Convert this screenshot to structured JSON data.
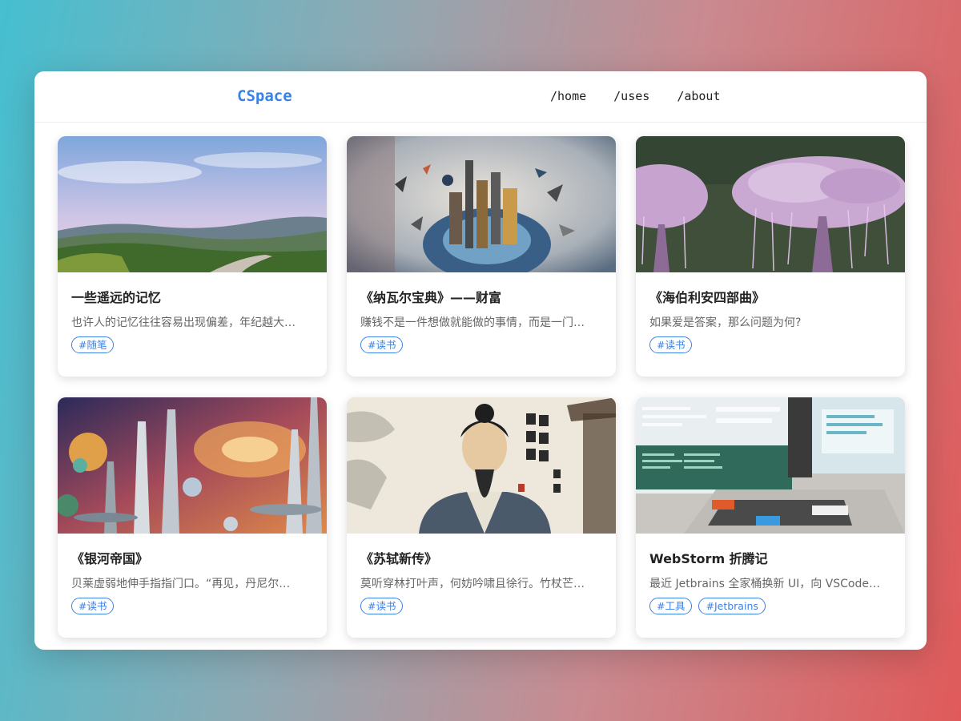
{
  "brand": "CSpace",
  "nav": [
    "/home",
    "/uses",
    "/about"
  ],
  "posts": [
    {
      "title": "一些遥远的记忆",
      "excerpt": "也许人的记忆往往容易出现偏差，年纪越大…",
      "tags": [
        "#随笔"
      ],
      "image": "landscape-hills-photo"
    },
    {
      "title": "《纳瓦尔宝典》——财富",
      "excerpt": "赚钱不是一件想做就能做的事情，而是一门…",
      "tags": [
        "#读书"
      ],
      "image": "abstract-city-collage-illustration"
    },
    {
      "title": "《海伯利安四部曲》",
      "excerpt": "如果爱是答案，那么问题为何?",
      "tags": [
        "#读书"
      ],
      "image": "glowing-pink-trees-illustration"
    },
    {
      "title": "《银河帝国》",
      "excerpt": "贝莱虚弱地伸手指指门口。“再见，丹尼尔…",
      "tags": [
        "#读书"
      ],
      "image": "scifi-galaxy-city-illustration"
    },
    {
      "title": "《苏轼新传》",
      "excerpt": "莫听穿林打叶声，何妨吟啸且徐行。竹杖芒…",
      "tags": [
        "#读书"
      ],
      "image": "ancient-scholar-portrait-illustration"
    },
    {
      "title": "WebStorm 折腾记",
      "excerpt": "最近 Jetbrains 全家桶换新 UI，向 VSCode…",
      "tags": [
        "#工具",
        "#Jetbrains"
      ],
      "image": "computer-desk-screens-illustration"
    }
  ]
}
